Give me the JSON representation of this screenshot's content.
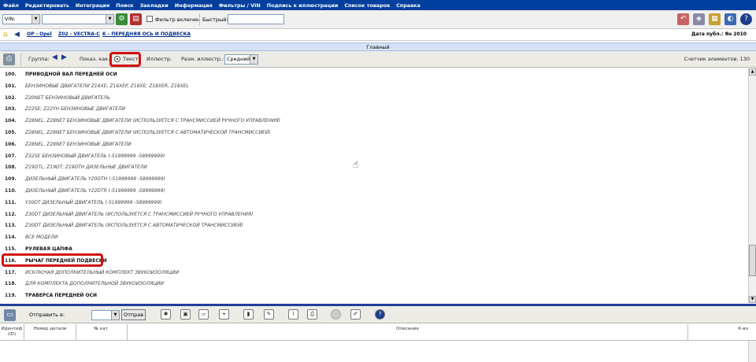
{
  "menu": [
    "Файл",
    "Редактировать",
    "Интеграция",
    "Поиск",
    "Закладки",
    "Информация",
    "Фильтры / VIN",
    "Подпись к иллюстрации",
    "Список товаров",
    "Справка"
  ],
  "toolbar1": {
    "vin_select": "VIN:",
    "vin_value": "",
    "filter_label": "Фильтр включен",
    "quick_label": "Быстрый:",
    "quick_value": ""
  },
  "breadcrumb": {
    "items": [
      "OP - Opel",
      "Z02 - VECTRA-C",
      "K - ПЕРЕДНЯЯ ОСЬ И ПОДВЕСКА"
    ],
    "pub_date": "Дата публ.: Ян 2010"
  },
  "section_title": "Главный",
  "toolbar2": {
    "group_label": "Группа:",
    "show_as_label": "Показ. как:",
    "text_option": "Текст",
    "illus_option": "Иллюстр.",
    "illus_size_label": "Разм. иллюстр.:",
    "illus_size_value": "Средний",
    "counter": "Счетчик элементов: 130"
  },
  "rows": [
    {
      "num": "100.",
      "text": "ПРИВОДНОЙ ВАЛ ПЕРЕДНЕЙ ОСИ",
      "bold": true
    },
    {
      "num": "101.",
      "text": "БЕНЗИНОВЫЕ ДВИГАТЕЛИ Z16XE; Z16XEP, Z18XE; Z18XER, Z18XEL",
      "bold": false
    },
    {
      "num": "102.",
      "text": "Z20NET БЕНЗИНОВЫЙ ДВИГАТЕЛЬ",
      "bold": false
    },
    {
      "num": "103.",
      "text": "Z22SE; Z22YH БЕНЗИНОВЫЕ ДВИГАТЕЛИ",
      "bold": false
    },
    {
      "num": "104.",
      "text": "Z28NEL, Z28NET БЕНЗИНОВЫЕ ДВИГАТЕЛИ (ИСПОЛЬЗУЕТСЯ С ТРАНСМИССИЕЙ РУЧНОГО УПРАВЛЕНИЯ)",
      "bold": false
    },
    {
      "num": "105.",
      "text": "Z28NEL, Z28NET БЕНЗИНОВЫЕ ДВИГАТЕЛИ (ИСПОЛЬЗУЕТСЯ С АВТОМАТИЧЕСКОЙ ТРАНСМИССИЕЙ)",
      "bold": false
    },
    {
      "num": "106.",
      "text": "Z28NEL, Z28NET БЕНЗИНОВЫЕ ДВИГАТЕЛИ",
      "bold": false
    },
    {
      "num": "107.",
      "text": "Z32SE БЕНЗИНОВЫЙ ДВИГАТЕЛЬ (-51999999 -58999999)",
      "bold": false
    },
    {
      "num": "108.",
      "text": "Z19DTL; Z19DT; Z19DTH ДИЗЕЛЬНЫЕ ДВИГАТЕЛИ",
      "bold": false
    },
    {
      "num": "109.",
      "text": "ДИЗЕЛЬНЫЙ ДВИГАТЕЛЬ Y20DTH (-51999999 -58999999)",
      "bold": false
    },
    {
      "num": "110.",
      "text": "ДИЗЕЛЬНЫЙ ДВИГАТЕЛЬ Y22DTR (-51999999 -58999999)",
      "bold": false
    },
    {
      "num": "111.",
      "text": "Y30DT ДИЗЕЛЬНЫЙ ДВИГАТЕЛЬ (-51999999 -58999999)",
      "bold": false
    },
    {
      "num": "112.",
      "text": "Z30DT ДИЗЕЛЬНЫЙ ДВИГАТЕЛЬ (ИСПОЛЬЗУЕТСЯ С ТРАНСМИССИЕЙ РУЧНОГО УПРАВЛЕНИЯ)",
      "bold": false
    },
    {
      "num": "113.",
      "text": "Z30DT ДИЗЕЛЬНЫЙ ДВИГАТЕЛЬ (ИСПОЛЬЗУЕТСЯ С АВТОМАТИЧЕСКОЙ ТРАНСМИССИЕЙ)",
      "bold": false
    },
    {
      "num": "114.",
      "text": "ВСЕ МОДЕЛИ",
      "bold": false
    },
    {
      "num": "115.",
      "text": "РУЛЕВАЯ ЦАПФА",
      "bold": true
    },
    {
      "num": "116.",
      "text": "РЫЧАГ ПЕРЕДНЕЙ ПОДВЕСКИ",
      "bold": true
    },
    {
      "num": "117.",
      "text": "ИСКЛЮЧАЯ ДОПОЛНИТЕЛЬНЫЙ КОМПЛЕКТ ЗВУКОИЗОЛЯЦИИ",
      "bold": false
    },
    {
      "num": "118.",
      "text": "ДЛЯ КОМПЛЕКТА ДОПОЛНИТЕЛЬНОЙ ЗВУКОИЗОЛЯЦИИ",
      "bold": false
    },
    {
      "num": "119.",
      "text": "ТРАВЕРСА ПЕРЕДНЕЙ ОСИ",
      "bold": true
    }
  ],
  "toolbar3": {
    "send_label": "Отправить в:",
    "send_value": "",
    "send_button": "Отправ"
  },
  "order_columns": [
    "Идентиф (ID)",
    "Номер детали",
    "№ кат.",
    "Описание",
    "К-во"
  ],
  "colors": {
    "menubar": "#003f9e",
    "highlight": "#d01010",
    "divider": "#1f3f9a"
  }
}
